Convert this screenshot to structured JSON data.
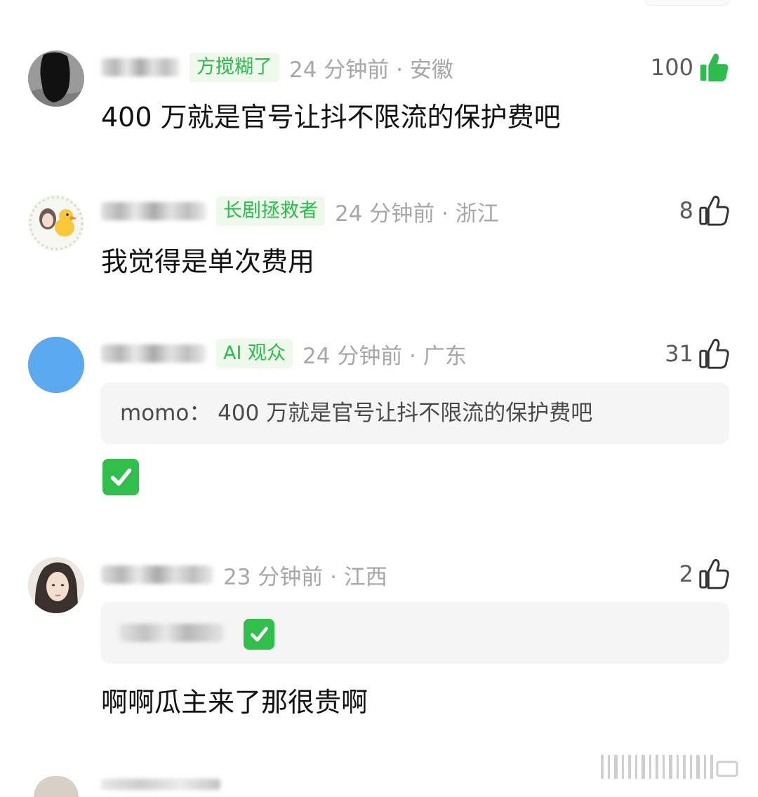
{
  "comments": [
    {
      "badge": "方搅糊了",
      "time_location": "24 分钟前 · 安徽",
      "likes": "100",
      "liked": true,
      "text": "400 万就是官号让抖不限流的保护费吧"
    },
    {
      "badge": "长剧拯救者",
      "time_location": "24 分钟前 · 浙江",
      "likes": "8",
      "liked": false,
      "text": "我觉得是单次费用"
    },
    {
      "badge": "AI 观众",
      "time_location": "24 分钟前 · 广东",
      "likes": "31",
      "liked": false,
      "quote": "momo：  400 万就是官号让抖不限流的保护费吧",
      "reply_emoji_name": "check-mark-button-icon"
    },
    {
      "time_location": "23 分钟前 · 江西",
      "likes": "2",
      "liked": false,
      "quote_emoji_name": "check-mark-button-icon",
      "text": "啊啊瓜主来了那很贵啊"
    }
  ],
  "colors": {
    "accent_green": "#2dbd4e",
    "badge_bg": "#eef9ec",
    "meta_gray": "#a7a7a7",
    "quote_bg": "#f5f5f5"
  }
}
